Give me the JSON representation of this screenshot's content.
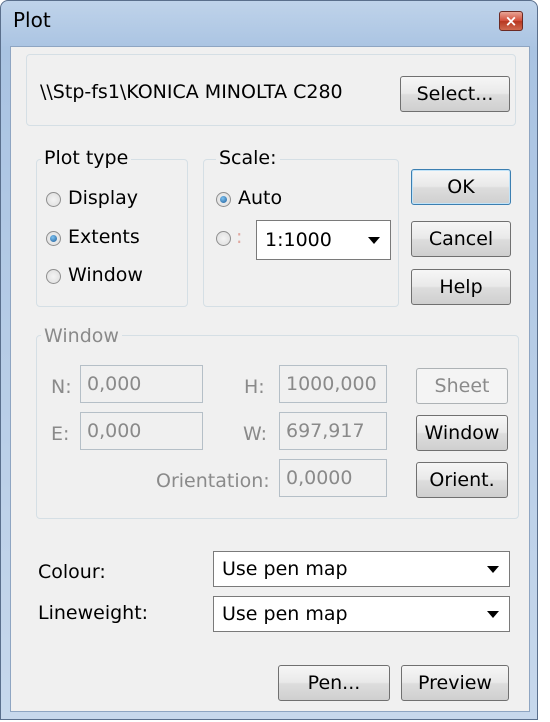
{
  "window": {
    "title": "Plot",
    "close_glyph": "×"
  },
  "printer": {
    "name": "\\\\Stp-fs1\\KONICA MINOLTA C280",
    "select_label": "Select..."
  },
  "plot_type": {
    "label": "Plot type",
    "options": [
      {
        "label": "Display",
        "selected": false
      },
      {
        "label": "Extents",
        "selected": true
      },
      {
        "label": "Window",
        "selected": false
      }
    ]
  },
  "scale": {
    "label": "Scale:",
    "auto_label": "Auto",
    "auto_selected": true,
    "custom_label_fragment": ":",
    "custom_value": "1:1000"
  },
  "buttons": {
    "ok": "OK",
    "cancel": "Cancel",
    "help": "Help"
  },
  "window_group": {
    "label": "Window",
    "n_label": "N:",
    "n_value": "0,000",
    "h_label": "H:",
    "h_value": "1000,000",
    "e_label": "E:",
    "e_value": "0,000",
    "w_label": "W:",
    "w_value": "697,917",
    "orientation_label": "Orientation:",
    "orientation_value": "0,0000",
    "sheet_label": "Sheet",
    "window_label": "Window",
    "orient_label": "Orient."
  },
  "colour": {
    "label": "Colour:",
    "value": "Use pen map"
  },
  "lineweight": {
    "label": "Lineweight:",
    "value": "Use pen map"
  },
  "bottom": {
    "pen_label": "Pen...",
    "preview_label": "Preview"
  },
  "colors": {
    "titlebar": "#a9c3e2",
    "close_button": "#c8462f",
    "dialog_bg": "#f0f0f0"
  }
}
